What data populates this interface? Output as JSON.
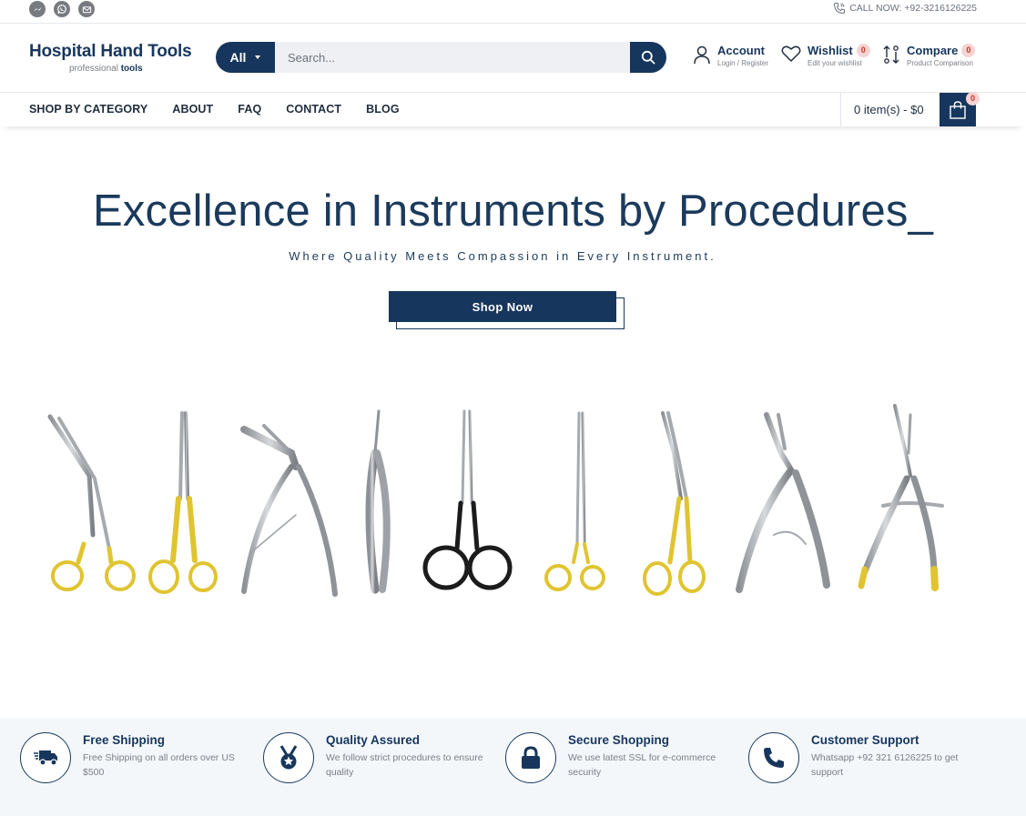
{
  "topbar": {
    "social_icons": [
      "messenger-icon",
      "whatsapp-icon",
      "email-icon"
    ],
    "call_now": "CALL NOW: +92-3216126225"
  },
  "header": {
    "logo_title": "Hospital Hand Tools",
    "logo_sub_light": "professional",
    "logo_sub_bold": "tools",
    "search": {
      "category": "All",
      "placeholder": "Search..."
    },
    "account": {
      "title": "Account",
      "sub": "Login / Register"
    },
    "wishlist": {
      "title": "Wishlist",
      "count": "0",
      "sub": "Edit your wishlist"
    },
    "compare": {
      "title": "Compare",
      "count": "0",
      "sub": "Product Comparison"
    }
  },
  "nav": {
    "items": [
      "SHOP BY CATEGORY",
      "ABOUT",
      "FAQ",
      "CONTACT",
      "BLOG"
    ],
    "cart_text": "0 item(s) - $0",
    "cart_count": "0"
  },
  "hero": {
    "title": "Excellence in Instruments by Procedures_",
    "subtitle": "Where Quality Meets Compassion in Every Instrument.",
    "cta": "Shop Now"
  },
  "colors": {
    "primary": "#17365d",
    "gold": "#e0c430",
    "silver": "#a9adb2",
    "badge_bg": "#f7d3d3"
  },
  "features": [
    {
      "icon": "truck-icon",
      "title": "Free Shipping",
      "desc": "Free Shipping on all orders over US $500"
    },
    {
      "icon": "medal-icon",
      "title": "Quality Assured",
      "desc": "We follow strict procedures to ensure quality"
    },
    {
      "icon": "lock-icon",
      "title": "Secure Shopping",
      "desc": "We use latest SSL for e-commerce security"
    },
    {
      "icon": "phone-icon",
      "title": "Customer Support",
      "desc": "Whatsapp +92 321 6126225 to get support"
    }
  ]
}
